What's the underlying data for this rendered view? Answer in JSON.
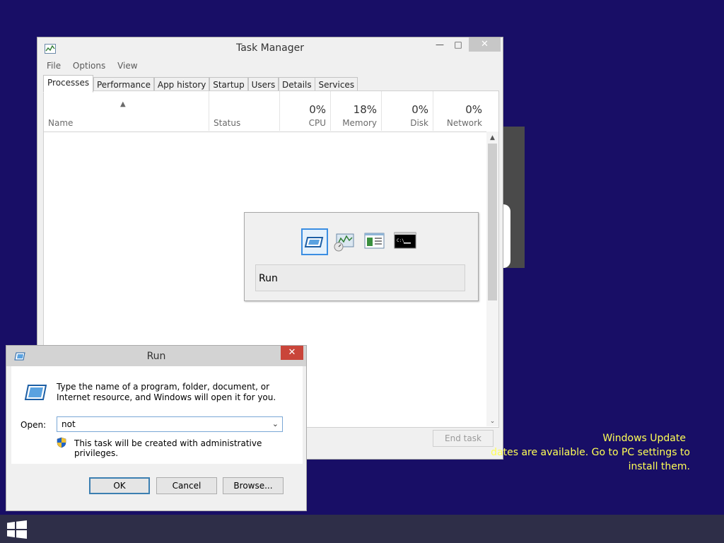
{
  "task_manager": {
    "title": "Task Manager",
    "menu": [
      "File",
      "Options",
      "View"
    ],
    "tabs": [
      "Processes",
      "Performance",
      "App history",
      "Startup",
      "Users",
      "Details",
      "Services"
    ],
    "active_tab": "Processes",
    "columns": {
      "name": "Name",
      "status": "Status",
      "cpu": {
        "pct": "0%",
        "label": "CPU"
      },
      "memory": {
        "pct": "18%",
        "label": "Memory"
      },
      "disk": {
        "pct": "0%",
        "label": "Disk"
      },
      "network": {
        "pct": "0%",
        "label": "Network"
      }
    },
    "end_task_label": "End task"
  },
  "switcher": {
    "selected_label": "Run",
    "icons": [
      "run-icon",
      "performance-monitor-icon",
      "task-manager-icon",
      "command-prompt-icon"
    ]
  },
  "run_dialog": {
    "title": "Run",
    "prompt": "Type the name of a program, folder, document, or Internet resource, and Windows will open it for you.",
    "open_label": "Open:",
    "open_value": "not",
    "admin_note": "This task will be created with administrative privileges.",
    "buttons": {
      "ok": "OK",
      "cancel": "Cancel",
      "browse": "Browse..."
    }
  },
  "windows_update": {
    "title": "Windows Update",
    "line1": "dates are available. Go to PC settings to",
    "line2": "install them."
  },
  "colors": {
    "desktop": "#180e66",
    "taskbar": "#2e2e48",
    "toast_text": "#ffff55",
    "selection_border": "#3b8ee2",
    "close_red": "#c9453a"
  }
}
